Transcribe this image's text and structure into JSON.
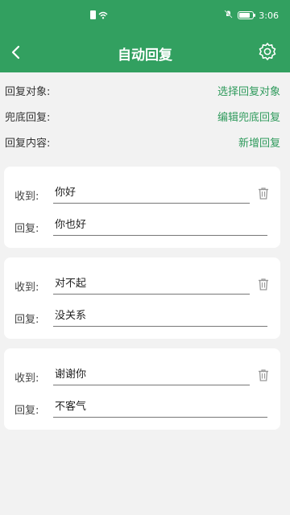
{
  "status_bar": {
    "time": "3:06",
    "battery_percent": 80
  },
  "header": {
    "title": "自动回复"
  },
  "settings": [
    {
      "label": "回复对象:",
      "action": "选择回复对象"
    },
    {
      "label": "兜底回复:",
      "action": "编辑兜底回复"
    },
    {
      "label": "回复内容:",
      "action": "新增回复"
    }
  ],
  "rules": [
    {
      "receive_label": "收到:",
      "receive": "你好",
      "reply_label": "回复:",
      "reply": "你也好"
    },
    {
      "receive_label": "收到:",
      "receive": "对不起",
      "reply_label": "回复:",
      "reply": "没关系"
    },
    {
      "receive_label": "收到:",
      "receive": "谢谢你",
      "reply_label": "回复:",
      "reply": "不客气"
    }
  ],
  "icons": {
    "back": "chevron-left-icon",
    "settings": "gear-icon",
    "delete": "trash-icon",
    "wifi": "wifi-icon",
    "sim": "sim-card-icon",
    "mute": "mute-icon",
    "battery": "battery-icon"
  },
  "colors": {
    "header": "#32a060",
    "accent": "#2f9a5c",
    "background": "#f2f2f2"
  }
}
